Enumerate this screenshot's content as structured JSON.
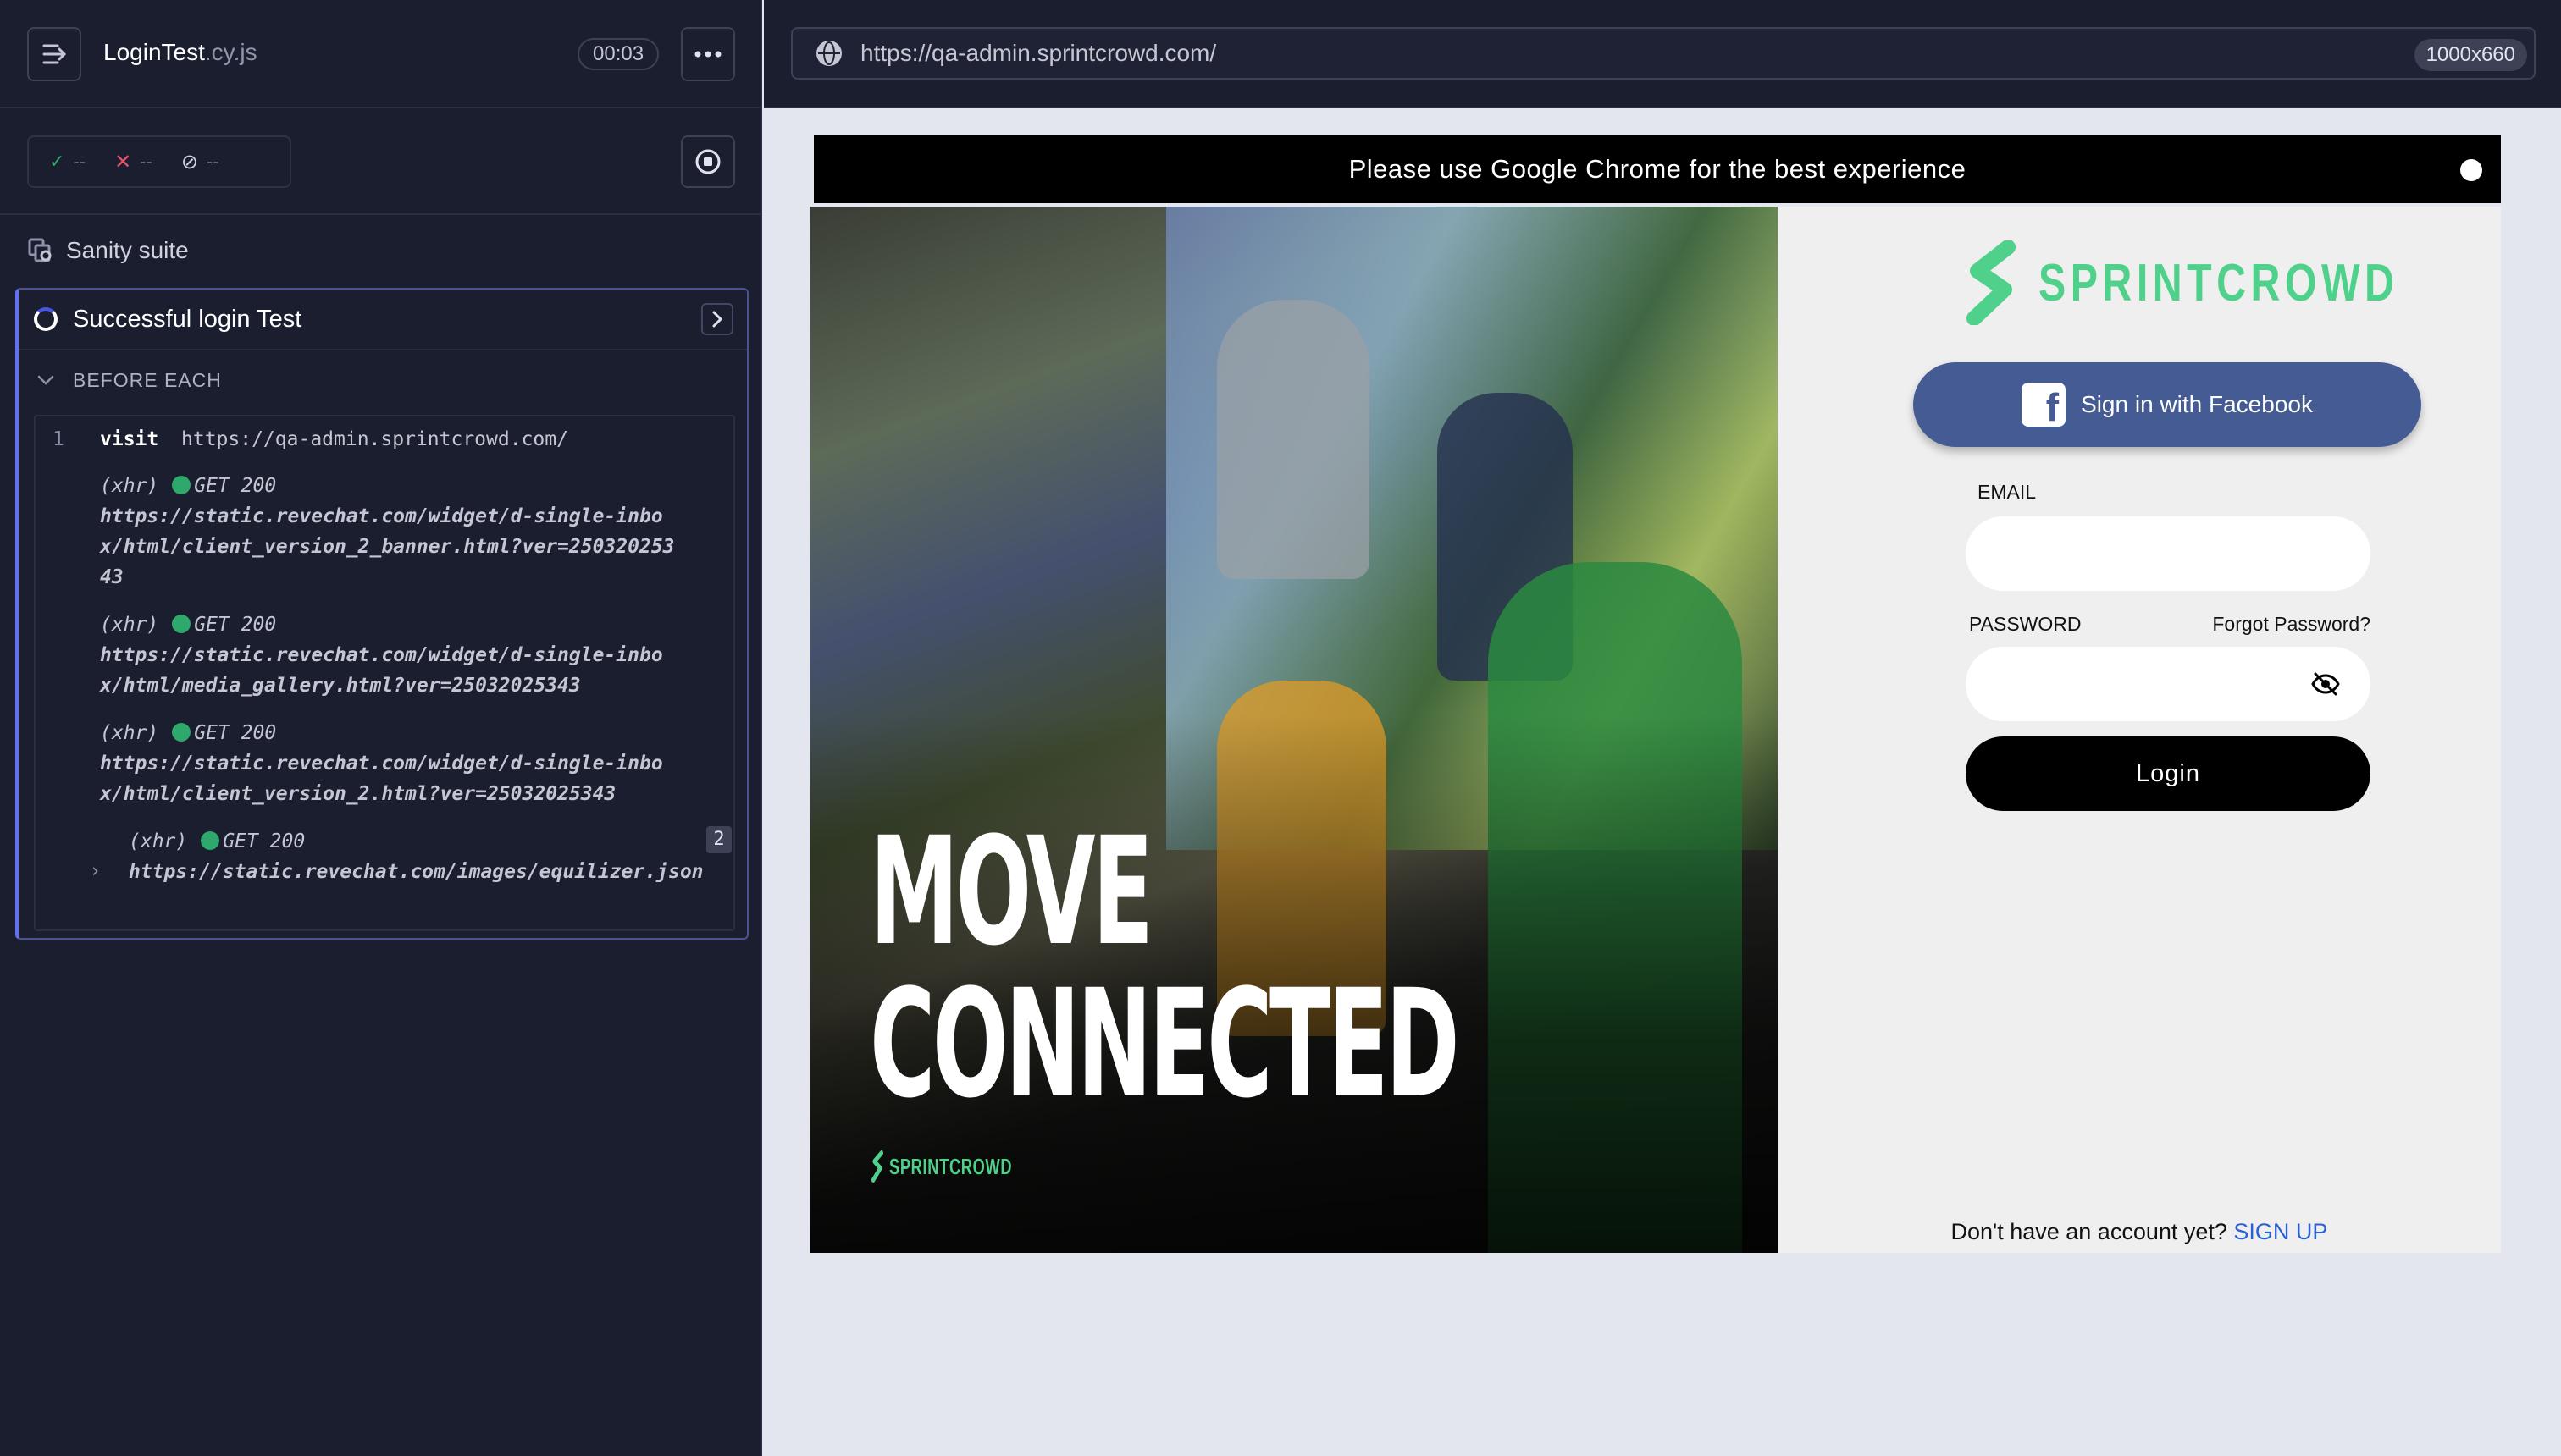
{
  "runner": {
    "spec_name": "LoginTest",
    "spec_ext": ".cy.js",
    "timer": "00:03",
    "stats": {
      "passed": "--",
      "failed": "--",
      "pending": "--"
    },
    "suite_title": "Sanity suite",
    "test_title": "Successful login Test",
    "hook_label": "BEFORE EACH",
    "commands": [
      {
        "num": "1",
        "name": "visit",
        "message": "https://qa-admin.sprintcrowd.com/"
      }
    ],
    "xhr": [
      {
        "type": "(xhr)",
        "status": "GET 200",
        "url": "https://static.revechat.com/widget/d-single-inbox/html/client_version_2_banner.html?ver=25032025343"
      },
      {
        "type": "(xhr)",
        "status": "GET 200",
        "url": "https://static.revechat.com/widget/d-single-inbox/html/media_gallery.html?ver=25032025343"
      },
      {
        "type": "(xhr)",
        "status": "GET 200",
        "url": "https://static.revechat.com/widget/d-single-inbox/html/client_version_2.html?ver=25032025343"
      },
      {
        "type": "(xhr)",
        "status": "GET 200",
        "url": "https://static.revechat.com/images/equilizer.json",
        "count": "2"
      }
    ]
  },
  "browser": {
    "url": "https://qa-admin.sprintcrowd.com/",
    "viewport": "1000x660"
  },
  "app": {
    "banner_text": "Please use Google Chrome for the best experience",
    "hero_line1": "MOVE",
    "hero_line2": "CONNECTED",
    "hero_logo": "SPRINTCROWD",
    "logo_text": "SPRINTCROWD",
    "facebook_button": "Sign in with Facebook",
    "email_label": "EMAIL",
    "password_label": "PASSWORD",
    "forgot_password": "Forgot Password?",
    "login_button": "Login",
    "signup_prompt": "Don't have an account yet?",
    "signup_link": "SIGN UP"
  },
  "colors": {
    "brand_green": "#4fd18b",
    "facebook_blue": "#445b94",
    "runner_bg": "#1b1e2e",
    "accent_indigo": "#6470f3",
    "success_dot": "#2fa86c"
  },
  "icons": [
    "runner-toggle-icon",
    "more-icon",
    "check-icon",
    "x-icon",
    "pending-icon",
    "stop-icon",
    "suite-icon",
    "spinner-icon",
    "chevron-right-icon",
    "chevron-down-icon",
    "globe-icon",
    "close-icon",
    "facebook-icon",
    "eye-off-icon"
  ]
}
